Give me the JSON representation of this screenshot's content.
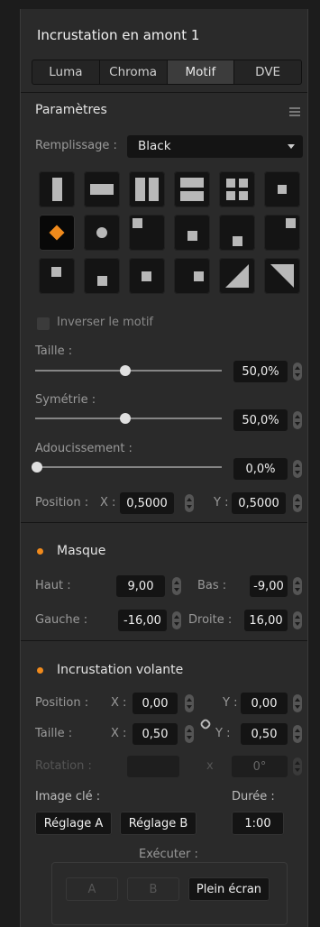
{
  "panel": {
    "title": "Incrustation en amont 1"
  },
  "tabs": [
    "Luma",
    "Chroma",
    "Motif",
    "DVE"
  ],
  "active_tab": "Motif",
  "params": {
    "header": "Paramètres",
    "fill_label": "Remplissage :",
    "fill_value": "Black",
    "invert_label": "Inverser le motif",
    "invert_checked": false,
    "size_label": "Taille :",
    "size_value": "50,0%",
    "size_level": 0.5,
    "symmetry_label": "Symétrie :",
    "symmetry_value": "50,0%",
    "symmetry_level": 0.5,
    "softness_label": "Adoucissement :",
    "softness_value": "0,0%",
    "softness_level": 0.0,
    "position_label": "Position :",
    "x_label": "X :",
    "x_value": "0,5000",
    "y_label": "Y :",
    "y_value": "0,5000"
  },
  "patterns": [
    "horizontal-bar",
    "vertical-bar",
    "horizontal-barn-door",
    "vertical-barn-door",
    "corners-in",
    "box",
    "diamond",
    "circle",
    "top-left-box",
    "top-center-box",
    "top-right-box",
    "left-center-box",
    "center-box",
    "right-center-box",
    "bottom-left-box",
    "bottom-center-box",
    "bottom-right-box",
    "top-left-diagonal",
    "top-right-diagonal",
    "bottom-right-diagonal"
  ],
  "selected_pattern": "diamond",
  "accent_color": "#f08a1c",
  "mask": {
    "header": "Masque",
    "top_label": "Haut :",
    "top_value": "9,00",
    "bottom_label": "Bas :",
    "bottom_value": "-9,00",
    "left_label": "Gauche :",
    "left_value": "-16,00",
    "right_label": "Droite :",
    "right_value": "16,00"
  },
  "flying": {
    "header": "Incrustation volante",
    "position_label": "Position :",
    "pos_x_label": "X :",
    "pos_x_value": "0,00",
    "pos_y_label": "Y :",
    "pos_y_value": "0,00",
    "size_label": "Taille :",
    "size_x_label": "X :",
    "size_x_value": "0,50",
    "size_y_label": "Y :",
    "size_y_value": "0,50",
    "rotation_label": "Rotation :",
    "rotation_x_label": "x",
    "rotation_value": "0°",
    "keyframe_label": "Image clé :",
    "set_a_label": "Réglage A",
    "set_b_label": "Réglage B",
    "duration_label": "Durée :",
    "duration_value": "1:00",
    "run_label": "Exécuter :",
    "run_a_label": "A",
    "run_b_label": "B",
    "run_full_label": "Plein écran"
  }
}
